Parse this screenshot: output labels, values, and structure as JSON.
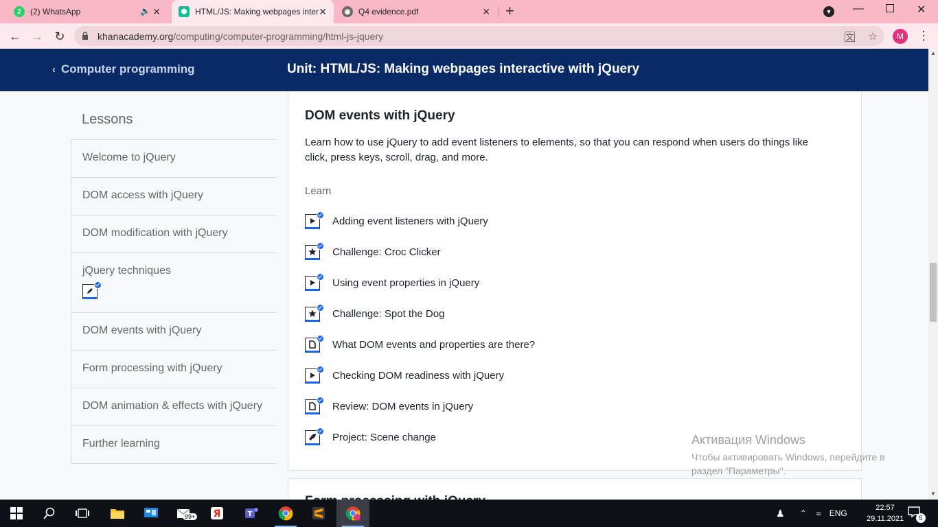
{
  "browser": {
    "tabs": [
      {
        "title": "(2) WhatsApp",
        "favicon": "whatsapp-icon",
        "color": "#25d366",
        "badge": "2",
        "muted": true
      },
      {
        "title": "HTML/JS: Making webpages inter",
        "favicon": "khan-academy-icon",
        "color": "#14bf96",
        "active": true
      },
      {
        "title": "Q4 evidence.pdf",
        "favicon": "globe-icon",
        "color": "#6b6b6b"
      }
    ],
    "url_host": "khanacademy.org",
    "url_path": "/computing/computer-programming/html-js-jquery",
    "profile_initial": "M"
  },
  "header": {
    "back_label": "Computer programming",
    "unit_title": "Unit: HTML/JS: Making webpages interactive with jQuery"
  },
  "sidebar": {
    "heading": "Lessons",
    "items": [
      {
        "label": "Welcome to jQuery"
      },
      {
        "label": "DOM access with jQuery"
      },
      {
        "label": "DOM modification with jQuery"
      },
      {
        "label": "jQuery techniques",
        "badge": "pencil-icon"
      },
      {
        "label": "DOM events with jQuery"
      },
      {
        "label": "Form processing with jQuery"
      },
      {
        "label": "DOM animation & effects with jQuery"
      },
      {
        "label": "Further learning"
      }
    ]
  },
  "lesson_card": {
    "title": "DOM events with jQuery",
    "description": "Learn how to use jQuery to add event listeners to elements, so that you can respond when users do things like click, press keys, scroll, drag, and more.",
    "section_label": "Learn",
    "items": [
      {
        "label": "Adding event listeners with jQuery",
        "icon": "video-icon"
      },
      {
        "label": "Challenge: Croc Clicker",
        "icon": "star-icon"
      },
      {
        "label": "Using event properties in jQuery",
        "icon": "video-icon"
      },
      {
        "label": "Challenge: Spot the Dog",
        "icon": "star-icon"
      },
      {
        "label": "What DOM events and properties are there?",
        "icon": "article-icon"
      },
      {
        "label": "Checking DOM readiness with jQuery",
        "icon": "video-icon"
      },
      {
        "label": "Review: DOM events in jQuery",
        "icon": "article-icon"
      },
      {
        "label": "Project: Scene change",
        "icon": "rocket-icon"
      }
    ]
  },
  "next_card": {
    "title_peek": "Form processing with jQuery"
  },
  "watermark": {
    "line1": "Активация Windows",
    "line2": "Чтобы активировать Windows, перейдите в раздел \"Параметры\"."
  },
  "taskbar": {
    "time": "22:57",
    "date": "29.11.2021",
    "language": "ENG",
    "notifications": "5",
    "mail_badge": "99+"
  },
  "colors": {
    "tab_strip": "#f9b8c8",
    "header_bg": "#0a2a66",
    "accent": "#1865f2"
  }
}
